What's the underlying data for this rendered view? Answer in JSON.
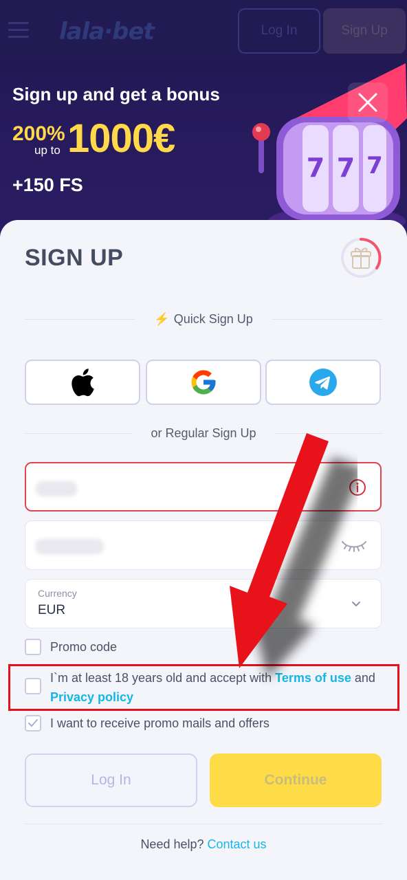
{
  "header": {
    "logo": "lala·bet",
    "login_label": "Log In",
    "signup_label": "Sign Up"
  },
  "hero": {
    "title": "Sign up and get a bonus",
    "percent": "200%",
    "up_to": "up to",
    "amount": "1000€",
    "free_spins": "+150 FS"
  },
  "form": {
    "title": "SIGN UP",
    "quick_signup": "Quick Sign Up",
    "regular_signup": "or Regular Sign Up",
    "currency_label": "Currency",
    "currency_value": "EUR",
    "promo_label": "Promo code",
    "terms_prefix": "I`m at least 18 years old and accept with ",
    "terms_link": "Terms of use",
    "terms_and": " and",
    "privacy_link": "Privacy policy",
    "promo_mails_label": "I want to receive promo mails and offers",
    "promo_mails_checked": true,
    "login_label": "Log In",
    "continue_label": "Continue",
    "help_text": "Need help? ",
    "contact_link": "Contact us"
  },
  "colors": {
    "accent_yellow": "#fddc48",
    "link_cyan": "#15b6e3",
    "error_red": "#e0444f",
    "hero_bg": "#221a52"
  },
  "icons": {
    "apple": "apple-icon",
    "google": "google-icon",
    "telegram": "telegram-icon",
    "info": "info-icon",
    "eye_closed": "eye-closed-icon",
    "chevron": "chevron-down-icon",
    "gift": "gift-icon",
    "close": "close-icon"
  }
}
